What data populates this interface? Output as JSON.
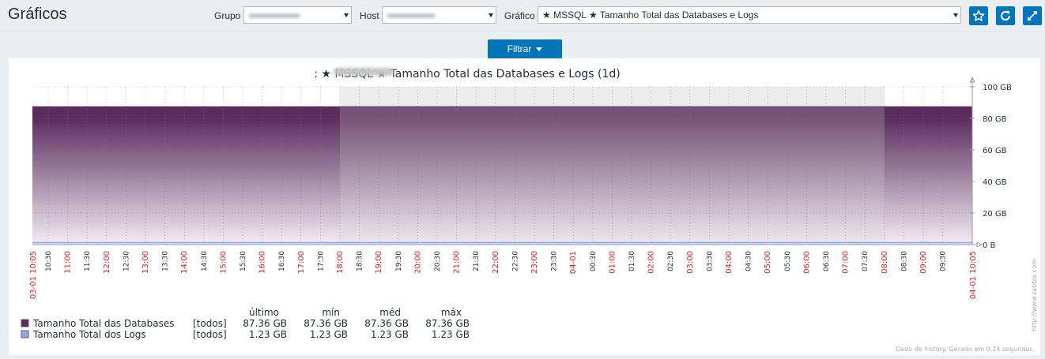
{
  "page": {
    "title": "Gráficos"
  },
  "filters": {
    "group_label": "Grupo",
    "host_label": "Host",
    "graph_label": "Gráfico",
    "graph_value": "★ MSSQL ★ Tamanho Total das Databases e Logs",
    "filter_button": "Filtrar"
  },
  "icons": {
    "favourite": "star-icon",
    "refresh": "refresh-icon",
    "fullscreen": "fullscreen-icon"
  },
  "colors": {
    "accent": "#0275b8",
    "databases_series": "#5b2c5e",
    "logs_series": "#8ea8ee",
    "hour_label": "#1f2c33",
    "midnight_label": "#dd1a1a"
  },
  "chart_data": {
    "type": "area",
    "title": ": ★ MSSQL ★ Tamanho Total das Databases e Logs (1d)",
    "y_unit": "GB",
    "ylim": [
      0,
      100
    ],
    "y_ticks": [
      "0 B",
      "20 GB",
      "40 GB",
      "60 GB",
      "80 GB",
      "100 GB"
    ],
    "y_tick_values": [
      0,
      20,
      40,
      60,
      80,
      100
    ],
    "x_start_label": "03-01 10:05",
    "x_end_label": "04-01 10:05",
    "x_ticks": [
      "10:30",
      "11:00",
      "11:30",
      "12:00",
      "12:30",
      "13:00",
      "13:30",
      "14:00",
      "14:30",
      "15:00",
      "15:30",
      "16:00",
      "16:30",
      "17:00",
      "17:30",
      "18:00",
      "18:30",
      "19:00",
      "19:30",
      "20:00",
      "20:30",
      "21:00",
      "21:30",
      "22:00",
      "22:30",
      "23:00",
      "23:30",
      "04-01",
      "00:30",
      "01:00",
      "01:30",
      "02:00",
      "02:30",
      "03:00",
      "03:30",
      "04:00",
      "04:30",
      "05:00",
      "05:30",
      "06:00",
      "06:30",
      "07:00",
      "07:30",
      "08:00",
      "08:30",
      "09:00",
      "09:30"
    ],
    "x_ticks_red": [
      "11:00",
      "12:00",
      "13:00",
      "14:00",
      "15:00",
      "16:00",
      "17:00",
      "18:00",
      "19:00",
      "20:00",
      "21:00",
      "22:00",
      "23:00",
      "04-01",
      "01:00",
      "02:00",
      "03:00",
      "04:00",
      "05:00",
      "06:00",
      "07:00",
      "08:00",
      "09:00"
    ],
    "shaded_period": [
      "18:00",
      "08:00"
    ],
    "grid": true,
    "series": [
      {
        "name": "Tamanho Total das Databases",
        "values": [
          87.36,
          87.36
        ],
        "func": "[todos]",
        "last": "87.36 GB",
        "min": "87.36 GB",
        "avg": "87.36 GB",
        "max": "87.36 GB"
      },
      {
        "name": "Tamanho Total dos Logs",
        "values": [
          1.23,
          1.23
        ],
        "func": "[todos]",
        "last": "1.23 GB",
        "min": "1.23 GB",
        "avg": "1.23 GB",
        "max": "1.23 GB"
      }
    ],
    "legend_headers": [
      "último",
      "mín",
      "méd",
      "máx"
    ],
    "side_text": "http://www.zabbix.com",
    "footer_text": "Dado de history. Gerado em 0.24 segundos."
  }
}
